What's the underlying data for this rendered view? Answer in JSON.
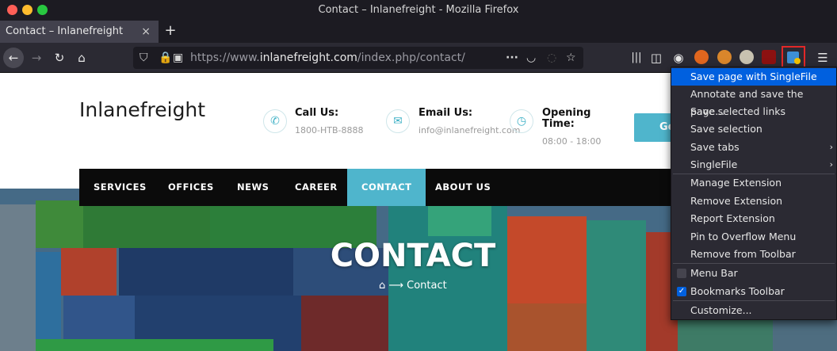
{
  "window": {
    "title": "Contact – Inlanefreight - Mozilla Firefox"
  },
  "tab": {
    "label": "Contact – Inlanefreight",
    "close": "×",
    "new_tab": "+"
  },
  "url": {
    "prefix": "https://www.",
    "domain": "inlanefreight.com",
    "path": "/index.php/contact/"
  },
  "site": {
    "logo": "Inlanefreight",
    "call_title": "Call Us:",
    "call_value": "1800-HTB-8888",
    "email_title": "Email Us:",
    "email_value": "info@inlanefreight.com",
    "hours_title_1": "Opening",
    "hours_title_2": "Time:",
    "hours_value": "08:00 - 18:00",
    "cta_partial": "Ge",
    "menu": [
      "SERVICES",
      "OFFICES",
      "NEWS",
      "CAREER",
      "CONTACT",
      "ABOUT US"
    ],
    "hero_title": "CONTACT",
    "breadcrumb": "Contact"
  },
  "dropdown": {
    "items": [
      "Save page with SingleFile",
      "Annotate and save the page...",
      "Save selected links",
      "Save selection",
      "Save tabs",
      "SingleFile",
      "Manage Extension",
      "Remove Extension",
      "Report Extension",
      "Pin to Overflow Menu",
      "Remove from Toolbar",
      "Menu Bar",
      "Bookmarks Toolbar",
      "Customize..."
    ]
  },
  "colors": {
    "accent": "#4fb5cc",
    "menu_highlight": "#0060df",
    "extension_outline": "#e22828"
  }
}
